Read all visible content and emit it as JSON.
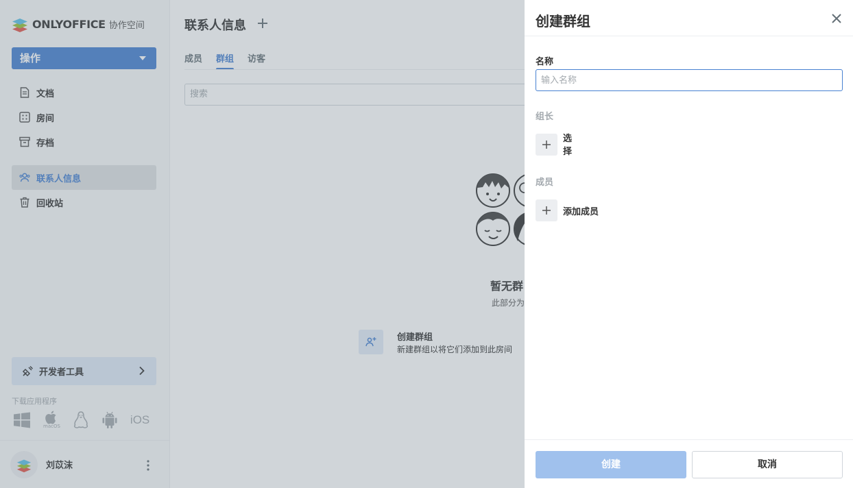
{
  "app": {
    "logo_word": "ONLYOFFICE",
    "logo_sub": "协作空间"
  },
  "sidebar": {
    "actions_label": "操作",
    "items": [
      {
        "label": "文档",
        "icon": "document-icon"
      },
      {
        "label": "房间",
        "icon": "rooms-icon"
      },
      {
        "label": "存档",
        "icon": "archive-icon"
      },
      {
        "label": "联系人信息",
        "icon": "contacts-icon",
        "active": true
      },
      {
        "label": "回收站",
        "icon": "trash-icon"
      }
    ],
    "dev_tools_label": "开发者工具",
    "download_label": "下载应用程序",
    "apps": {
      "macos": "macOS",
      "ios": "iOS"
    }
  },
  "profile": {
    "name": "刘苡沫"
  },
  "main": {
    "title": "联系人信息",
    "tabs": [
      {
        "label": "成员"
      },
      {
        "label": "群组",
        "active": true
      },
      {
        "label": "访客"
      }
    ],
    "search_placeholder": "搜索",
    "empty_title": "暂无群",
    "empty_sub": "此部分为",
    "create_group_title": "创建群组",
    "create_group_desc": "新建群组以将它们添加到此房间"
  },
  "panel": {
    "title": "创建群组",
    "name_label": "名称",
    "name_placeholder": "输入名称",
    "name_value": "",
    "head_label": "组长",
    "head_select": "选择",
    "members_label": "成员",
    "add_members": "添加成员",
    "create_button": "创建",
    "cancel_button": "取消"
  },
  "colors": {
    "accent": "#4781d1",
    "accent_disabled": "#a0c1ed",
    "sidebar_bg": "#f8f9f9",
    "overlay": "rgba(113,126,140,0.33)"
  }
}
